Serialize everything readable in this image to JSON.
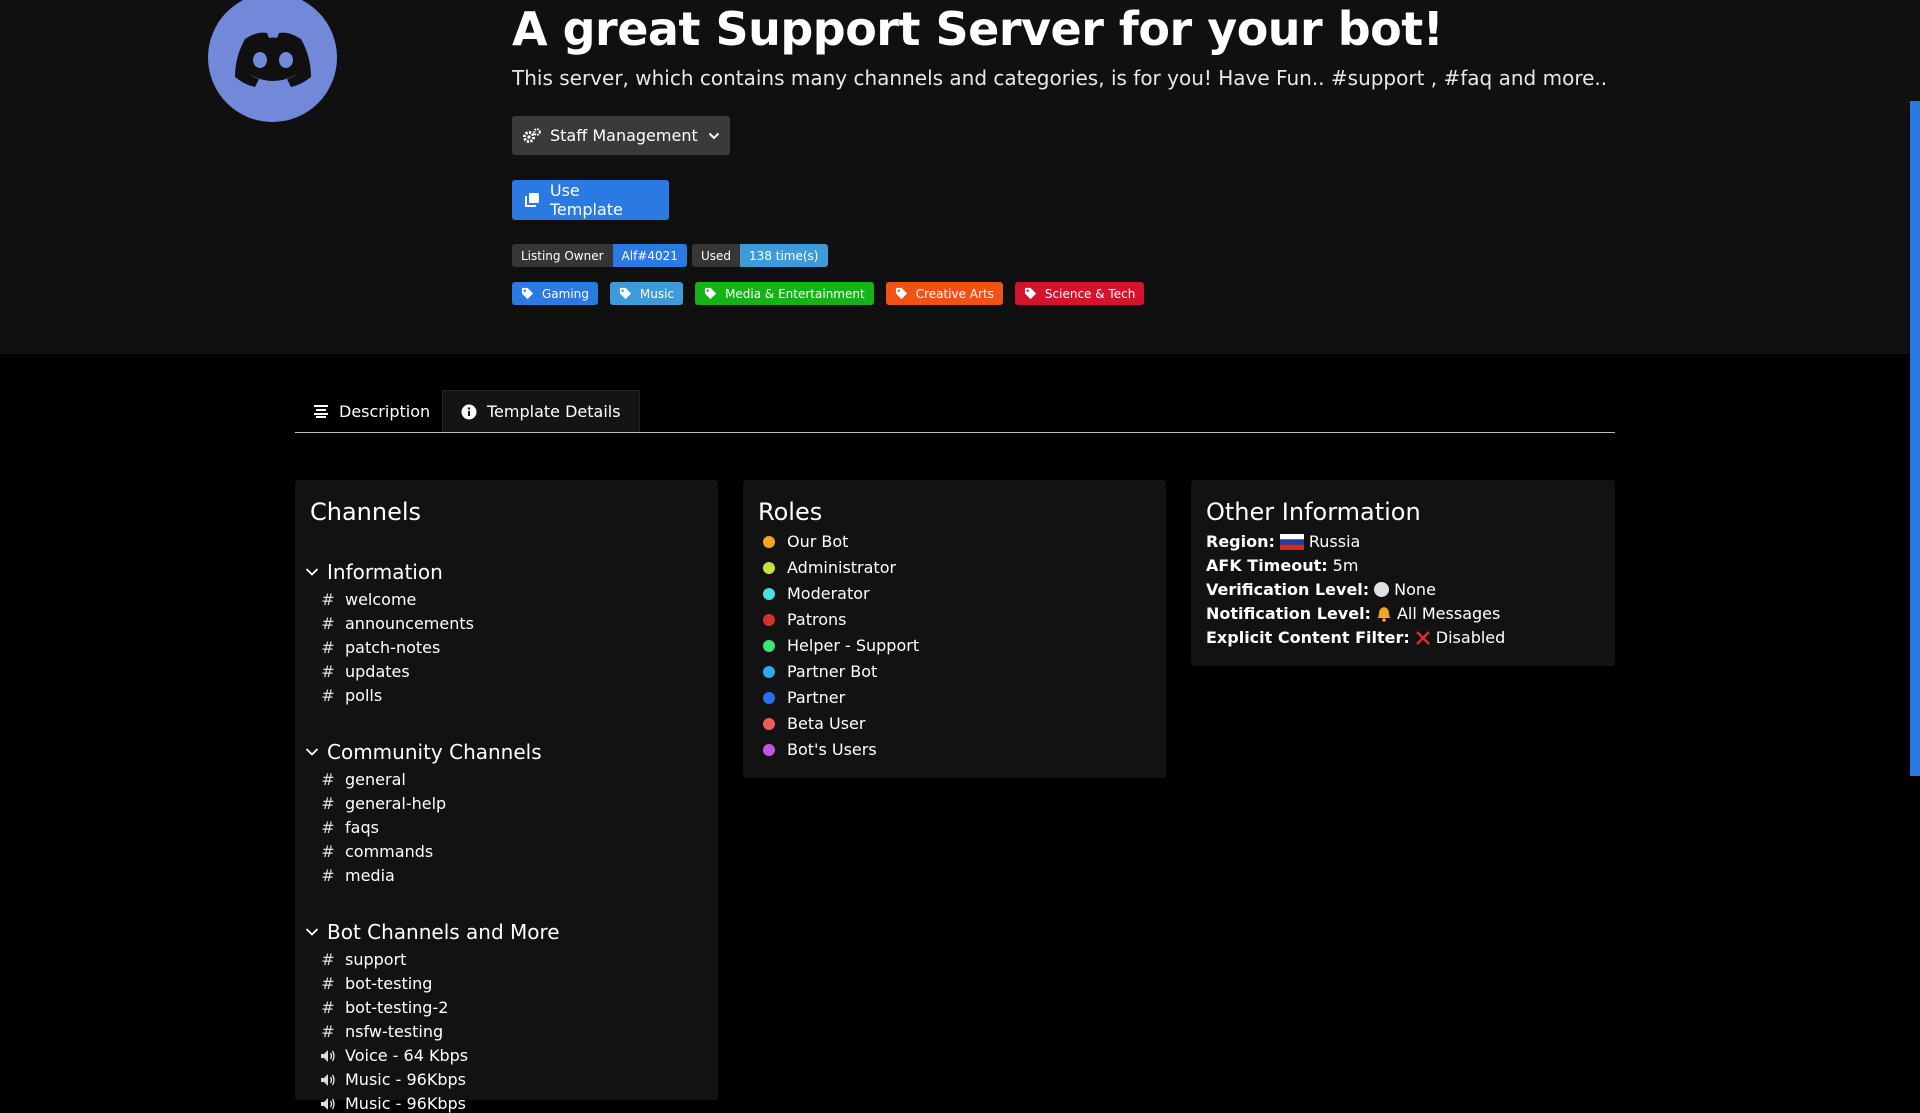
{
  "header": {
    "title": "A great Support Server for your bot!",
    "subtitle": "This server, which contains many channels and categories, is for you! Have Fun.. #support , #faq and more..",
    "dropdown_label": "Staff Management",
    "use_template_label": "Use Template",
    "owner_key": "Listing Owner",
    "owner_value": "Alf#4021",
    "used_key": "Used",
    "used_value": "138 time(s)",
    "tags": [
      {
        "label": "Gaming",
        "color": "#2a7ae2"
      },
      {
        "label": "Music",
        "color": "#3d9bd9"
      },
      {
        "label": "Media & Entertainment",
        "color": "#16b316"
      },
      {
        "label": "Creative Arts",
        "color": "#f25314"
      },
      {
        "label": "Science & Tech",
        "color": "#d4142a"
      }
    ]
  },
  "tabs": {
    "description": "Description",
    "template_details": "Template Details"
  },
  "channels": {
    "title": "Channels",
    "categories": [
      {
        "name": "Information",
        "channels": [
          {
            "name": "welcome",
            "type": "text"
          },
          {
            "name": "announcements",
            "type": "text"
          },
          {
            "name": "patch-notes",
            "type": "text"
          },
          {
            "name": "updates",
            "type": "text"
          },
          {
            "name": "polls",
            "type": "text"
          }
        ]
      },
      {
        "name": "Community Channels",
        "channels": [
          {
            "name": "general",
            "type": "text"
          },
          {
            "name": "general-help",
            "type": "text"
          },
          {
            "name": "faqs",
            "type": "text"
          },
          {
            "name": "commands",
            "type": "text"
          },
          {
            "name": "media",
            "type": "text"
          }
        ]
      },
      {
        "name": "Bot Channels and More",
        "channels": [
          {
            "name": "support",
            "type": "text"
          },
          {
            "name": "bot-testing",
            "type": "text"
          },
          {
            "name": "bot-testing-2",
            "type": "text"
          },
          {
            "name": "nsfw-testing",
            "type": "text"
          },
          {
            "name": "Voice - 64 Kbps",
            "type": "voice"
          },
          {
            "name": "Music - 96Kbps",
            "type": "voice"
          },
          {
            "name": "Music - 96Kbps",
            "type": "voice"
          }
        ]
      }
    ]
  },
  "roles": {
    "title": "Roles",
    "items": [
      {
        "name": "Our Bot",
        "color": "#f5a524"
      },
      {
        "name": "Administrator",
        "color": "#c5e33c"
      },
      {
        "name": "Moderator",
        "color": "#4ae0e0"
      },
      {
        "name": "Patrons",
        "color": "#d43232"
      },
      {
        "name": "Helper - Support",
        "color": "#3ee27a"
      },
      {
        "name": "Partner Bot",
        "color": "#2ea9f0"
      },
      {
        "name": "Partner",
        "color": "#2a6ff0"
      },
      {
        "name": "Beta User",
        "color": "#f05a5a"
      },
      {
        "name": "Bot's Users",
        "color": "#c256e6"
      }
    ]
  },
  "other": {
    "title": "Other Information",
    "region_label": "Region:",
    "region_value": "Russia",
    "afk_label": "AFK Timeout:",
    "afk_value": "5m",
    "verification_label": "Verification Level:",
    "verification_value": "None",
    "notification_label": "Notification Level:",
    "notification_value": "All Messages",
    "filter_label": "Explicit Content Filter:",
    "filter_value": "Disabled"
  },
  "colors": {
    "accent": "#2a7ae2",
    "used_badge": "#3d9bd9",
    "discord_blurple": "#7289da"
  }
}
